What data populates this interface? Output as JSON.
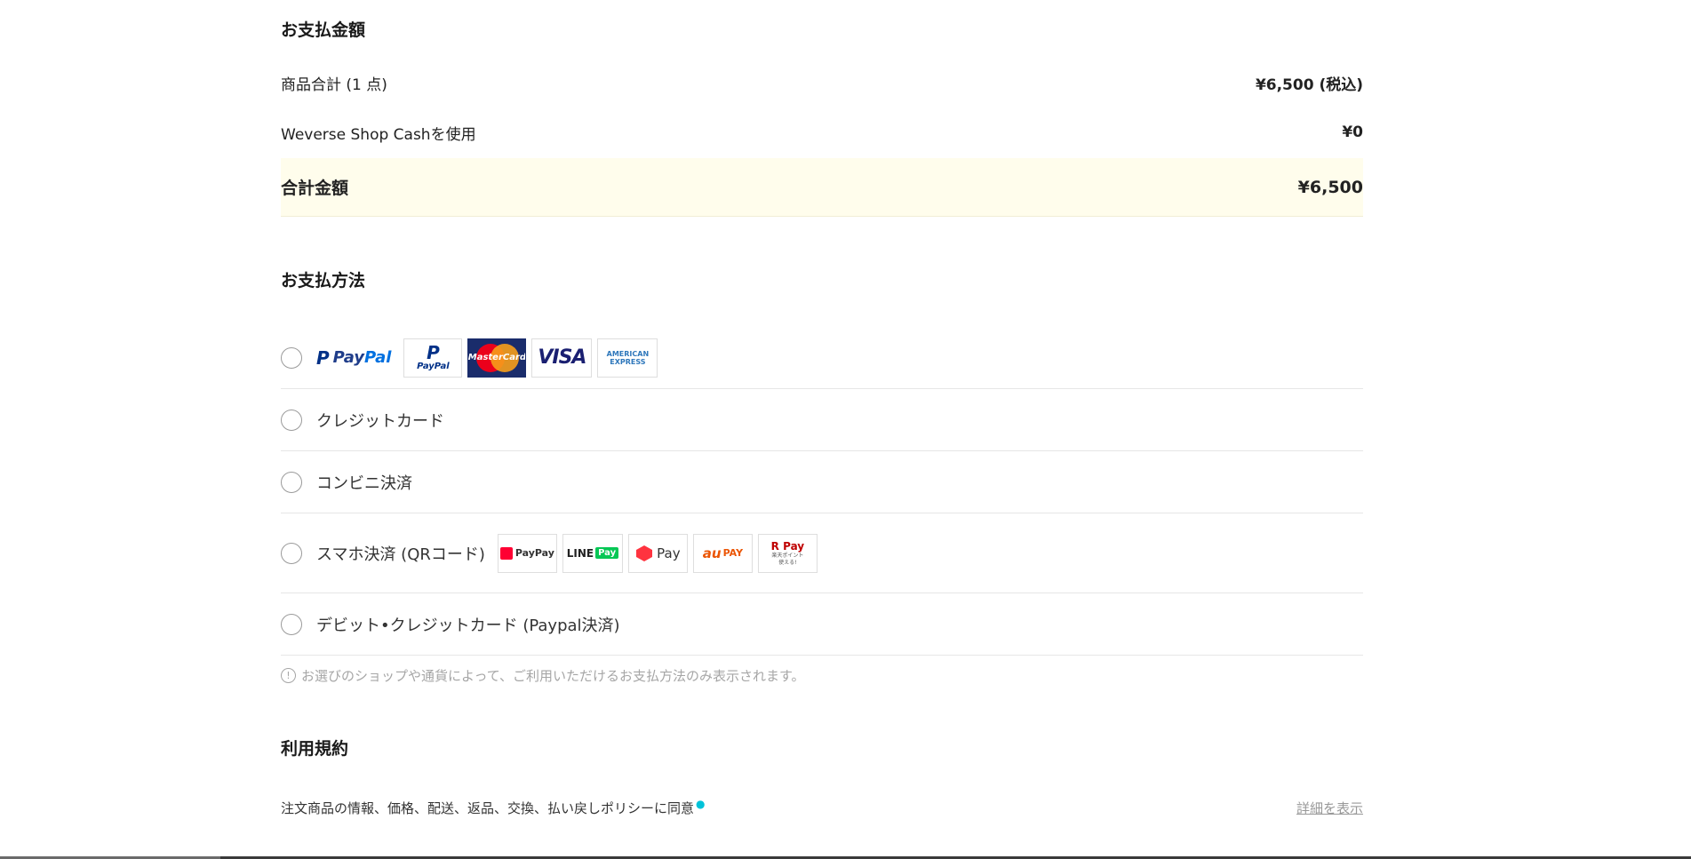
{
  "payment_amount": {
    "title": "お支払金額",
    "subtotal_label": "商品合計 (1 点)",
    "subtotal_value": "¥6,500 (税込)",
    "cash_label": "Weverse Shop Cashを使用",
    "cash_value": "¥0",
    "total_label": "合計金額",
    "total_value": "¥6,500"
  },
  "payment_method": {
    "title": "お支払方法",
    "paypal": {
      "brand_p": "P",
      "brand_text_pay": "Pay",
      "brand_text_pal": "Pal",
      "logo_paypal_small_p": "P",
      "logo_paypal_small_text": "PayPal",
      "logo_mastercard": "MasterCard",
      "logo_visa": "VISA",
      "logo_amex_1": "AMERICAN",
      "logo_amex_2": "EXPRESS"
    },
    "credit_card_label": "クレジットカード",
    "konbini_label": "コンビニ決済",
    "smartphone_label": "スマホ決済 (QRコード)",
    "smartphone_logos": {
      "paypay": "PayPay",
      "linepay_line": "LINE",
      "linepay_pay": "Pay",
      "merpay": "Pay",
      "aupay_au": "au",
      "aupay_pay": "PAY",
      "rpay": "R Pay",
      "rpay_sub1": "楽天ポイント",
      "rpay_sub2": "使える!"
    },
    "debit_label": "デビット•クレジットカード (Paypal決済)",
    "notice_icon": "!",
    "notice": "お選びのショップや通貨によって、ご利用いただけるお支払方法のみ表示されます。"
  },
  "terms": {
    "title": "利用規約",
    "agree_text": "注文商品の情報、価格、配送、返品、交換、払い戻しポリシーに同意",
    "required_mark": "●",
    "details_link": "詳細を表示"
  },
  "colors": {
    "paypal_blue": "#003087",
    "mastercard_bg": "#1a2c6b",
    "visa_blue": "#1a1f71",
    "amex_blue": "#2e77bb",
    "paypay_red": "#ff0033",
    "linepay_green": "#06c755",
    "merpay_red": "#ff333f",
    "aupay_orange": "#eb5505",
    "rpay_red": "#bf0000"
  }
}
